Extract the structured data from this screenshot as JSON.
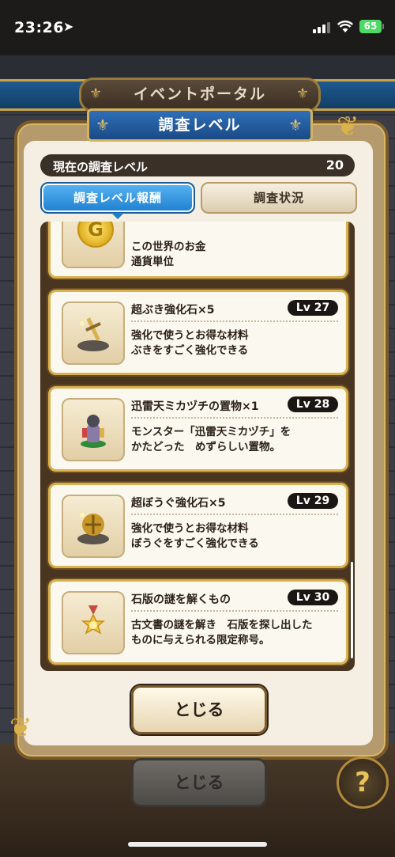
{
  "status_bar": {
    "time": "23:26",
    "battery": "65"
  },
  "background": {
    "portal_title": "イベントポータル",
    "close_label": "とじる",
    "help_label": "?"
  },
  "dialog": {
    "title": "調査レベル",
    "current_level_label": "現在の調査レベル",
    "current_level_value": "20",
    "tabs": [
      {
        "label": "調査レベル報酬",
        "active": true
      },
      {
        "label": "調査状況",
        "active": false
      }
    ],
    "rewards": [
      {
        "icon": "gold-coin-icon",
        "name": "",
        "level": "",
        "desc": "この世界のお金\n通貨単位"
      },
      {
        "icon": "weapon-upgrade-stone-icon",
        "name": "超ぶき強化石×5",
        "level": "Lv 27",
        "desc": "強化で使うとお得な材料\nぶきをすごく強化できる"
      },
      {
        "icon": "monster-figurine-icon",
        "name": "迅雷天ミカヅチの置物×1",
        "level": "Lv 28",
        "desc": "モンスター「迅雷天ミカヅチ」を\nかたどった　めずらしい置物。"
      },
      {
        "icon": "armor-upgrade-stone-icon",
        "name": "超ぼうぐ強化石×5",
        "level": "Lv 29",
        "desc": "強化で使うとお得な材料\nぼうぐをすごく強化できる"
      },
      {
        "icon": "medal-icon",
        "name": "石版の謎を解くもの",
        "level": "Lv 30",
        "desc": "古文書の謎を解き　石版を探し出した\nものに与えられる限定称号。"
      }
    ],
    "close_label": "とじる"
  },
  "colors": {
    "accent_blue": "#1f7fcf",
    "gold_border": "#d9b14d",
    "panel_brown": "#4a3620"
  }
}
